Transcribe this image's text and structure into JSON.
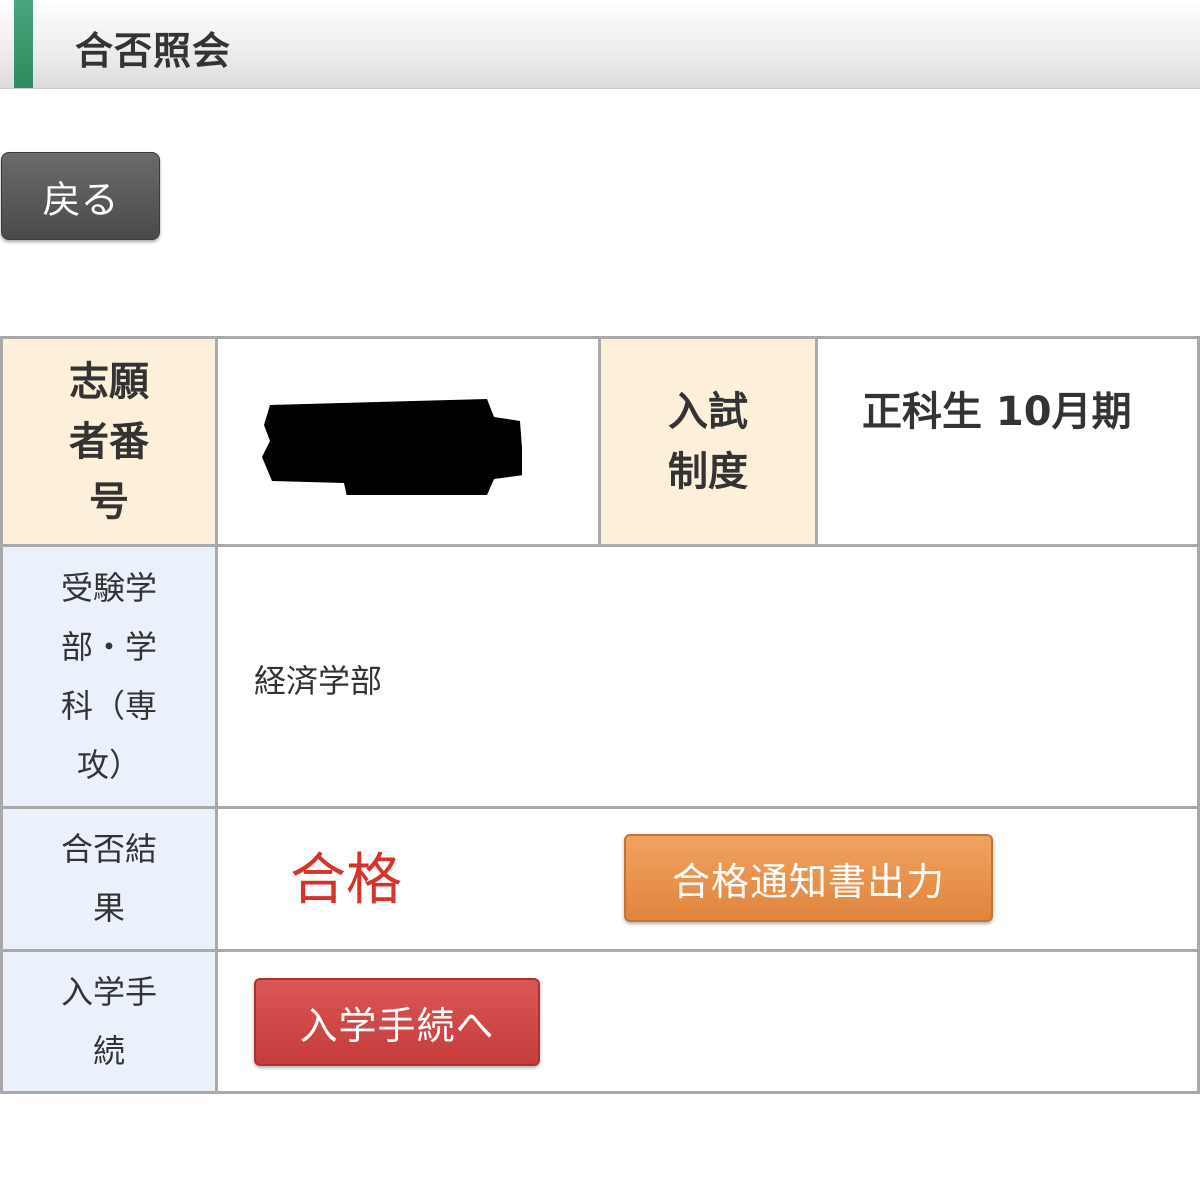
{
  "header": {
    "title": "合否照会"
  },
  "actions": {
    "back_label": "戻る"
  },
  "table": {
    "applicant_number_label": "志願者番号",
    "admission_system_label": "入試制度",
    "admission_system_value": "正科生 10月期",
    "department_label": "受験学部・学科（専攻）",
    "department_value": "経済学部",
    "result_label": "合否結果",
    "result_value": "合格",
    "notice_button_label": "合格通知書出力",
    "enrollment_label": "入学手続",
    "enrollment_button_label": "入学手続へ"
  },
  "colors": {
    "accent_green": "#2f8a5f",
    "result_red": "#d6332b",
    "notice_orange": "#e0843e",
    "enroll_red": "#c43c3c",
    "header_cell_bg": "#fdf0da",
    "label_cell_bg": "#eaf1fb"
  }
}
